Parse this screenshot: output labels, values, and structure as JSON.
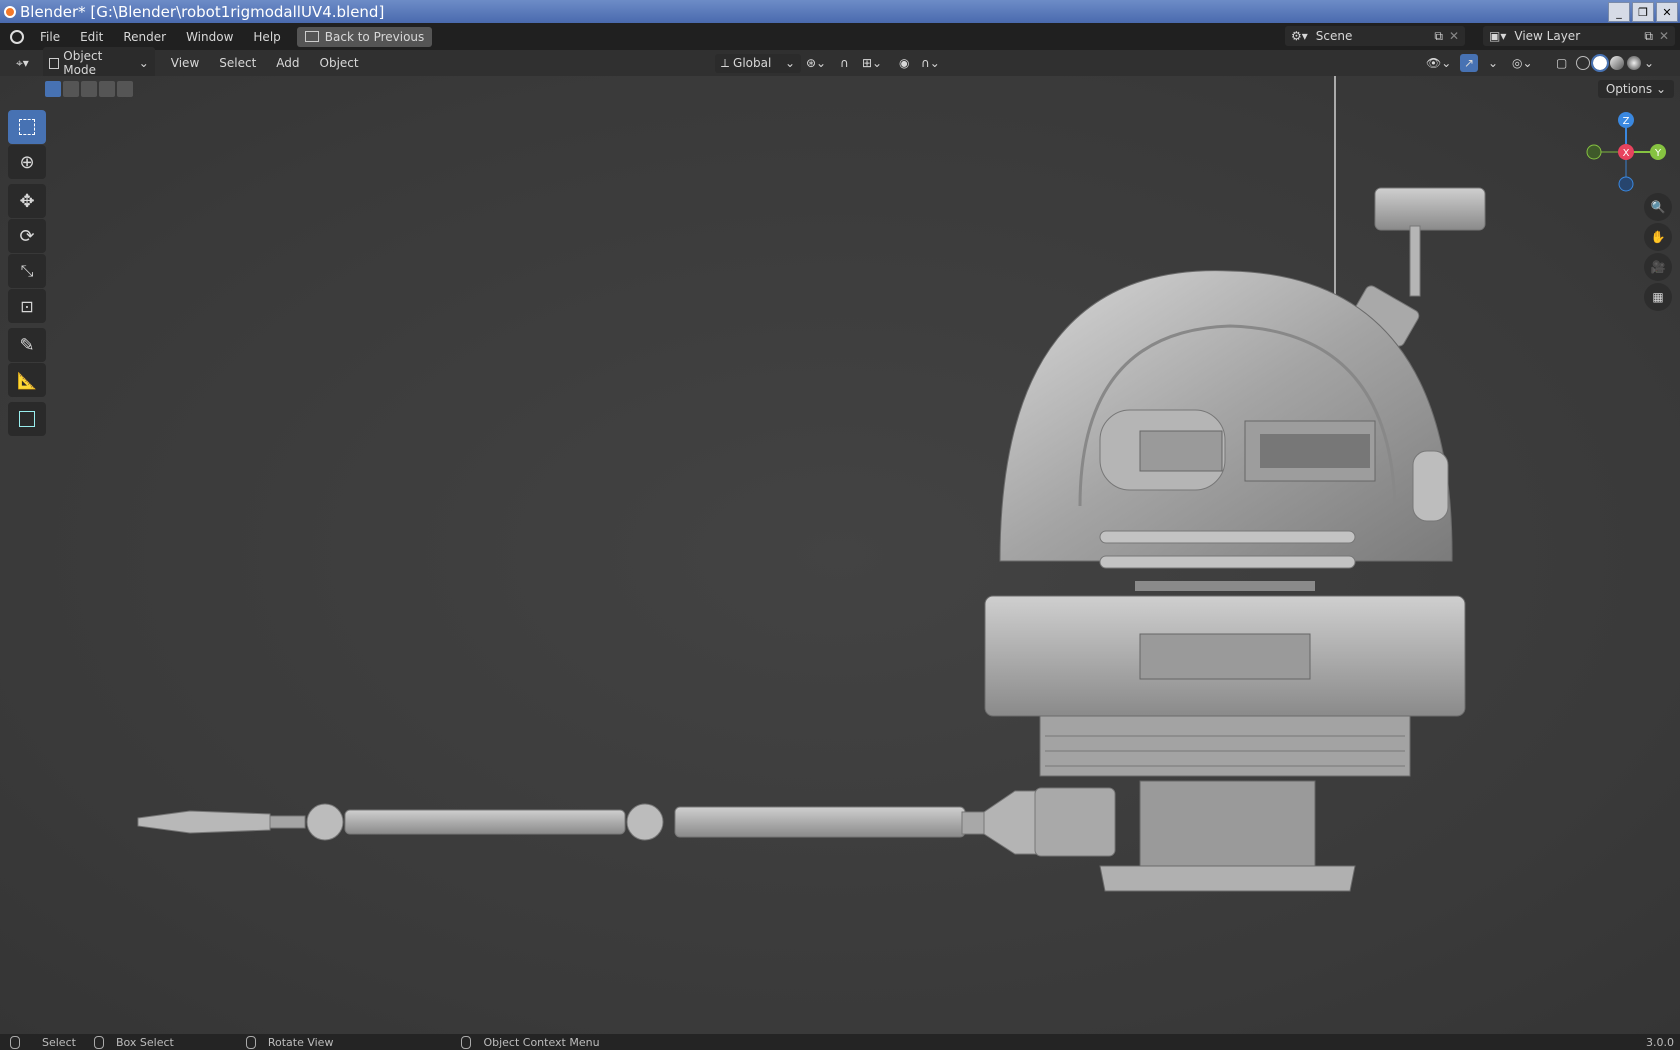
{
  "window": {
    "title": "Blender* [G:\\Blender\\robot1rigmodallUV4.blend]"
  },
  "menubar": {
    "items": [
      "File",
      "Edit",
      "Render",
      "Window",
      "Help"
    ],
    "back_label": "Back to Previous",
    "scene_label": "Scene",
    "view_layer_label": "View Layer"
  },
  "header3d": {
    "mode": "Object Mode",
    "menus": [
      "View",
      "Select",
      "Add",
      "Object"
    ],
    "orientation": "Global"
  },
  "viewport": {
    "options_label": "Options"
  },
  "gizmo": {
    "z": "Z",
    "x": "X",
    "y": "Y"
  },
  "statusbar": {
    "select": "Select",
    "box_select": "Box Select",
    "rotate": "Rotate View",
    "context": "Object Context Menu",
    "version": "3.0.0"
  },
  "colors": {
    "accent": "#4772b3",
    "axis_x": "#e8435e",
    "axis_y": "#86c341",
    "axis_z": "#3a88e0"
  }
}
